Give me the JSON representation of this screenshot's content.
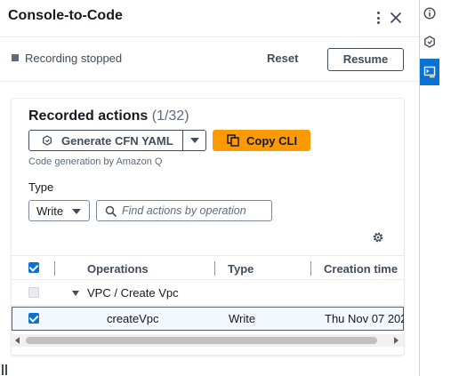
{
  "header": {
    "title": "Console-to-Code",
    "more_icon": "vertical-ellipsis-icon",
    "close_icon": "close-icon"
  },
  "recording": {
    "status": "Recording stopped",
    "reset_label": "Reset",
    "resume_label": "Resume"
  },
  "recorded_actions": {
    "title": "Recorded actions",
    "count": "(1/32)",
    "generate_label": "Generate CFN YAML",
    "copy_label": "Copy CLI",
    "generation_note": "Code generation by Amazon Q",
    "type_label": "Type",
    "type_value": "Write",
    "search_placeholder": "Find actions by operation"
  },
  "table": {
    "columns": [
      "Operations",
      "Type",
      "Creation time"
    ],
    "group": {
      "label": "VPC / Create Vpc"
    },
    "rows": [
      {
        "operation": "createVpc",
        "type": "Write",
        "creation_time": "Thu Nov 07 202"
      }
    ]
  },
  "side_rail": {
    "items": [
      {
        "icon": "info-icon",
        "active": false
      },
      {
        "icon": "hexagon-icon",
        "active": false
      },
      {
        "icon": "console-to-code-icon",
        "active": true
      }
    ]
  },
  "colors": {
    "accent": "#0972d3",
    "primary_button": "#ff9900",
    "text": "#16191f",
    "muted_text": "#5f6b7a",
    "border": "#e9ebed"
  }
}
